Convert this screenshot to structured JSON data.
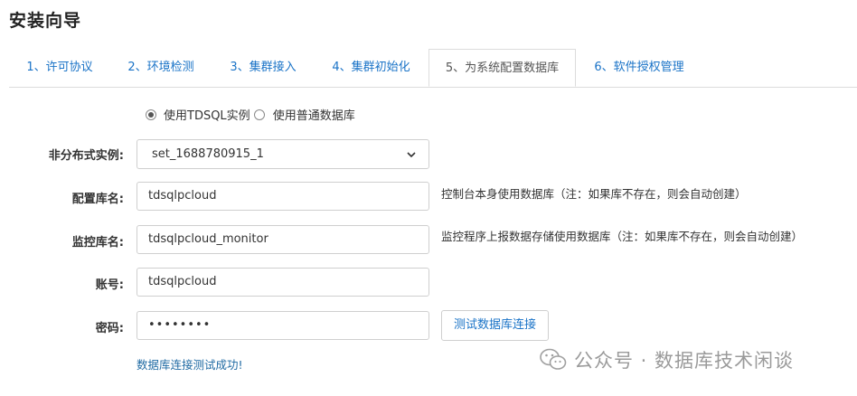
{
  "page": {
    "title": "安装向导"
  },
  "tabs": [
    {
      "label": "1、许可协议",
      "active": false
    },
    {
      "label": "2、环境检测",
      "active": false
    },
    {
      "label": "3、集群接入",
      "active": false
    },
    {
      "label": "4、集群初始化",
      "active": false
    },
    {
      "label": "5、为系统配置数据库",
      "active": true
    },
    {
      "label": "6、软件授权管理",
      "active": false
    }
  ],
  "db_type": {
    "options": [
      {
        "label": "使用TDSQL实例",
        "checked": true
      },
      {
        "label": "使用普通数据库",
        "checked": false
      }
    ]
  },
  "form": {
    "instance": {
      "label": "非分布式实例:",
      "value": "set_1688780915_1"
    },
    "config_db": {
      "label": "配置库名:",
      "value": "tdsqlpcloud",
      "hint": "控制台本身使用数据库（注：如果库不存在，则会自动创建）"
    },
    "monitor_db": {
      "label": "监控库名:",
      "value": "tdsqlpcloud_monitor",
      "hint": "监控程序上报数据存储使用数据库（注：如果库不存在，则会自动创建）"
    },
    "account": {
      "label": "账号:",
      "value": "tdsqlpcloud"
    },
    "password": {
      "label": "密码:",
      "value": "••••••••"
    }
  },
  "test_button": {
    "label": "测试数据库连接"
  },
  "status": {
    "text": "数据库连接测试成功!"
  },
  "watermark": {
    "text": "公众号 · 数据库技术闲谈"
  },
  "colors": {
    "link": "#1a73c7",
    "status": "#1f6aa3",
    "border": "#dcdcdc"
  }
}
